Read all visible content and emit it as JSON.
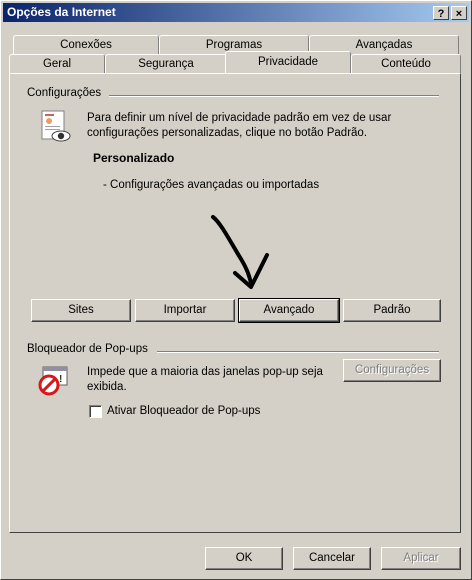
{
  "window": {
    "title": "Opções da Internet",
    "help_button": "?",
    "close_button": "×"
  },
  "tabs": {
    "row_back": [
      {
        "label": "Conexões"
      },
      {
        "label": "Programas"
      },
      {
        "label": "Avançadas"
      }
    ],
    "row_front": [
      {
        "label": "Geral"
      },
      {
        "label": "Segurança"
      },
      {
        "label": "Privacidade",
        "active": true
      },
      {
        "label": "Conteúdo"
      }
    ]
  },
  "settings": {
    "group_title": "Configurações",
    "description": "Para definir um nível de privacidade padrão em vez de usar configurações personalizadas, clique no botão Padrão.",
    "level_title": "Personalizado",
    "level_detail": "- Configurações avançadas ou importadas",
    "buttons": {
      "sites": "Sites",
      "import": "Importar",
      "advanced": "Avançado",
      "default": "Padrão"
    }
  },
  "popup_blocker": {
    "group_title": "Bloqueador de Pop-ups",
    "description": "Impede que a maioria das janelas pop-up seja exibida.",
    "settings_button": "Configurações",
    "checkbox_label": "Ativar Bloqueador de Pop-ups",
    "checkbox_checked": false
  },
  "footer": {
    "ok": "OK",
    "cancel": "Cancelar",
    "apply": "Aplicar"
  },
  "icons": {
    "privacy": "privacy-document-eye-icon",
    "popup": "popup-blocked-icon",
    "annotation": "hand-drawn-arrow"
  },
  "colors": {
    "face": "#d4d0c8",
    "titlebar_start": "#0a246a",
    "titlebar_end": "#a6caf0",
    "popup_icon_red": "#d81818"
  }
}
